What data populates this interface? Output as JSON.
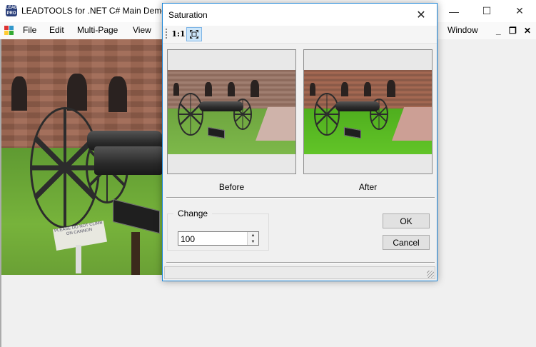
{
  "main_window": {
    "title": "LEADTOOLS for .NET C# Main Demo",
    "app_icon_text": "LEAD PRO",
    "controls": {
      "minimize": "—",
      "maximize": "☐",
      "close": "✕"
    }
  },
  "menu": {
    "items": [
      "File",
      "Edit",
      "Multi-Page",
      "View"
    ],
    "right_item": "Window",
    "mdi_controls": {
      "minimize": "_",
      "restore": "❐",
      "close": "✕"
    }
  },
  "background_image": {
    "sign_text": "PLEASE DO NOT CLIMB ON CANNON"
  },
  "dialog": {
    "title": "Saturation",
    "close_glyph": "✕",
    "toolbar": {
      "actual_size_label": "1:1",
      "fit_glyph": "⤢"
    },
    "before_label": "Before",
    "after_label": "After",
    "change_group_label": "Change",
    "change_value": "100",
    "spin_up_glyph": "▲",
    "spin_down_glyph": "▼",
    "ok_label": "OK",
    "cancel_label": "Cancel"
  },
  "colors": {
    "dialog_border": "#1883d7",
    "toolbar_active": "#cde6f9"
  }
}
